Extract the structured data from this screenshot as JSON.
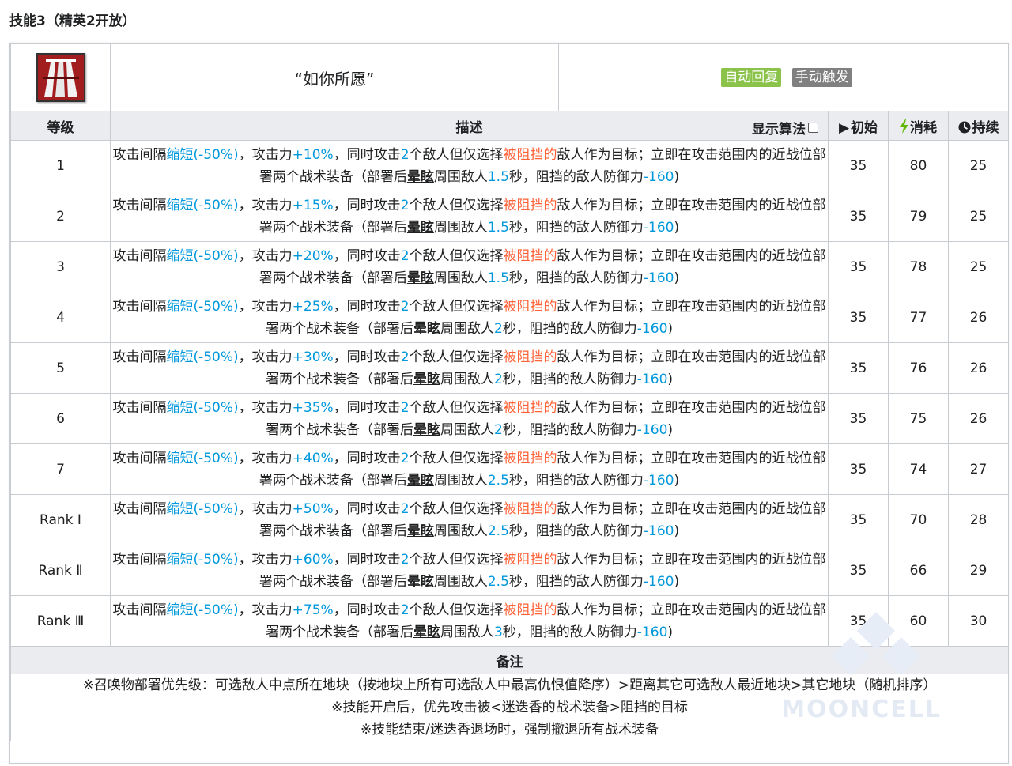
{
  "section_title": "技能3（精英2开放）",
  "skill": {
    "name": "“如你所愿”",
    "tags": [
      {
        "label": "自动回复",
        "color": "#8bc34a"
      },
      {
        "label": "手动触发",
        "color": "#808080"
      }
    ]
  },
  "headers": {
    "level": "等级",
    "description": "描述",
    "show_formula": "显示算法",
    "initial": "初始",
    "cost": "消耗",
    "duration": "持续"
  },
  "description_parts": {
    "p1": "攻击间隔",
    "interval": "缩短(-50%)",
    "p2": "，攻击力",
    "p3": "，同时攻击",
    "targets": "2",
    "p4": "个敌人但仅选择",
    "blocked": "被阻挡的",
    "p5": "敌人作为目标；立即在攻击范围内的近战位部署两个战术装备（部署后",
    "stun": "晕眩",
    "p6": "周围敌人",
    "p7": "秒，阻挡的敌人防御力",
    "def": "-160",
    "p8": ")"
  },
  "rows": [
    {
      "level": "1",
      "atk": "+10%",
      "stun_sec": "1.5",
      "initial": "35",
      "cost": "80",
      "duration": "25"
    },
    {
      "level": "2",
      "atk": "+15%",
      "stun_sec": "1.5",
      "initial": "35",
      "cost": "79",
      "duration": "25"
    },
    {
      "level": "3",
      "atk": "+20%",
      "stun_sec": "1.5",
      "initial": "35",
      "cost": "78",
      "duration": "25"
    },
    {
      "level": "4",
      "atk": "+25%",
      "stun_sec": "2",
      "initial": "35",
      "cost": "77",
      "duration": "26"
    },
    {
      "level": "5",
      "atk": "+30%",
      "stun_sec": "2",
      "initial": "35",
      "cost": "76",
      "duration": "26"
    },
    {
      "level": "6",
      "atk": "+35%",
      "stun_sec": "2",
      "initial": "35",
      "cost": "75",
      "duration": "26"
    },
    {
      "level": "7",
      "atk": "+40%",
      "stun_sec": "2.5",
      "initial": "35",
      "cost": "74",
      "duration": "27"
    },
    {
      "level": "Rank Ⅰ",
      "atk": "+50%",
      "stun_sec": "2.5",
      "initial": "35",
      "cost": "70",
      "duration": "28"
    },
    {
      "level": "Rank Ⅱ",
      "atk": "+60%",
      "stun_sec": "2.5",
      "initial": "35",
      "cost": "66",
      "duration": "29"
    },
    {
      "level": "Rank Ⅲ",
      "atk": "+75%",
      "stun_sec": "3",
      "initial": "35",
      "cost": "60",
      "duration": "30"
    }
  ],
  "notes": {
    "title": "备注",
    "lines": [
      "※召唤物部署优先级：可选敌人中点所在地块（按地块上所有可选敌人中最高仇恨值降序）>距离其它可选敌人最近地块>其它地块（随机排序）",
      "※技能开启后，优先攻击被<迷迭香的战术装备>阻挡的目标",
      "※技能结束/迷迭香退场时，强制撤退所有战术装备"
    ]
  },
  "watermark": "MOONCELL",
  "icons": {
    "initial": "play-triangle-icon",
    "cost": "lightning-bolt-icon",
    "duration": "clock-icon",
    "skill": "skill-icon"
  },
  "colors": {
    "highlight_blue": "#0098dc",
    "highlight_orange": "#ff6237",
    "header_bg": "#eaecf0",
    "bolt_green": "#5fb800"
  }
}
